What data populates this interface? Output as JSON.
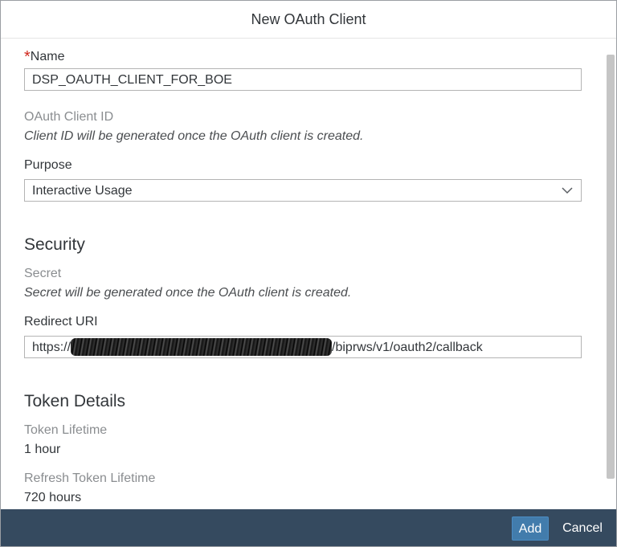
{
  "dialog": {
    "title": "New OAuth Client"
  },
  "form": {
    "name": {
      "required_marker": "*",
      "label": "Name",
      "value": "DSP_OAUTH_CLIENT_FOR_BOE"
    },
    "client_id": {
      "label": "OAuth Client ID",
      "note": "Client ID will be generated once the OAuth client is created."
    },
    "purpose": {
      "label": "Purpose",
      "value": "Interactive Usage",
      "icon": "chevron-down-icon"
    },
    "security": {
      "heading": "Security",
      "secret_label": "Secret",
      "secret_note": "Secret will be generated once the OAuth client is created.",
      "redirect_label": "Redirect URI",
      "redirect_prefix": "https://",
      "redirect_suffix": "/biprws/v1/oauth2/callback"
    },
    "token": {
      "heading": "Token Details",
      "lifetime_label": "Token Lifetime",
      "lifetime_value": "1 hour",
      "refresh_label": "Refresh Token Lifetime",
      "refresh_value": "720 hours"
    }
  },
  "footer": {
    "add_label": "Add",
    "cancel_label": "Cancel"
  },
  "colors": {
    "footer_bg": "#354a5f",
    "primary_button": "#427cac",
    "required": "#d0271d"
  }
}
